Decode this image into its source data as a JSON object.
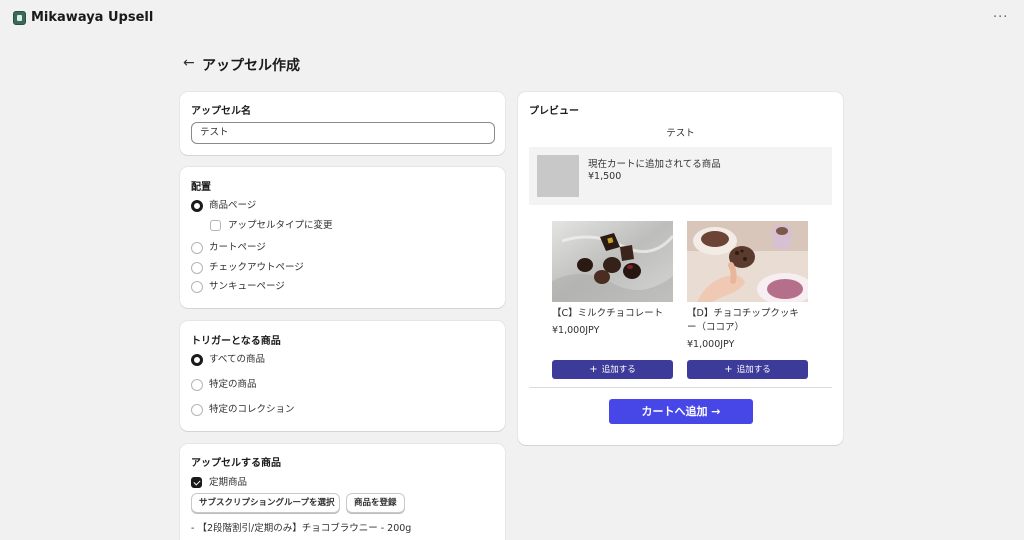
{
  "app": {
    "title": "Mikawaya Upsell",
    "more_icon": "ellipsis-icon"
  },
  "page": {
    "title": "アップセル作成",
    "back_icon": "arrow-left-icon"
  },
  "upsell_name": {
    "title": "アップセル名",
    "value": "テスト"
  },
  "placement": {
    "title": "配置",
    "options": [
      "商品ページ",
      "カートページ",
      "チェックアウトページ",
      "サンキューページ"
    ],
    "selected": "商品ページ",
    "sub_checkbox": {
      "label": "アップセルタイプに変更",
      "checked": false
    }
  },
  "trigger": {
    "title": "トリガーとなる商品",
    "options": [
      "すべての商品",
      "特定の商品",
      "特定のコレクション"
    ],
    "selected": "すべての商品"
  },
  "upsell_products": {
    "title": "アップセルする商品",
    "checkbox": {
      "label": "定期商品",
      "checked": true
    },
    "buttons": [
      "サブスクリプショングループを選択",
      "商品を登録"
    ],
    "items": [
      "- 【2段階割引/定期のみ】チョコブラウニー - 200g"
    ]
  },
  "preview": {
    "title": "プレビュー",
    "name": "テスト",
    "current": {
      "label": "現在カートに追加されてる商品",
      "price": "¥1,500"
    },
    "products": [
      {
        "name": "【C】ミルクチョコレート",
        "price": "¥1,000JPY",
        "button": "追加する"
      },
      {
        "name": "【D】チョコチップクッキー（ココア）",
        "price": "¥1,000JPY",
        "button": "追加する"
      }
    ],
    "cart_button": "カートへ追加 →"
  },
  "colors": {
    "primary": "#4747e8",
    "add_button": "#3d3b99",
    "background": "#f1f1f1"
  }
}
